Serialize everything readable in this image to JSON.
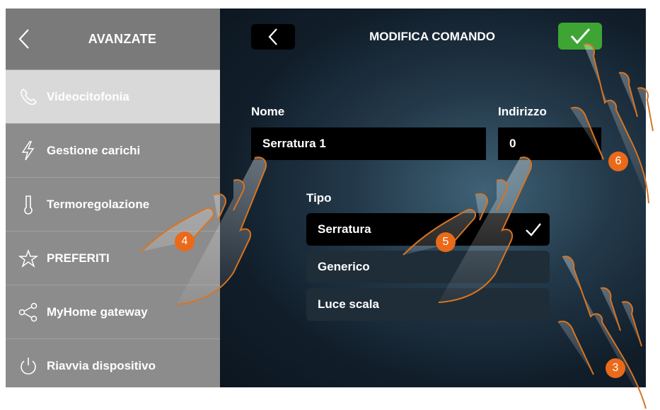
{
  "sidebar": {
    "back_icon": "chevron-left-icon",
    "title": "AVANZATE",
    "items": [
      {
        "label": "Videocitofonia",
        "icon": "phone-icon",
        "active": true
      },
      {
        "label": "Gestione carichi",
        "icon": "lightning-icon",
        "active": false
      },
      {
        "label": "Termoregolazione",
        "icon": "thermometer-icon",
        "active": false
      },
      {
        "label": "PREFERITI",
        "icon": "star-icon",
        "active": false
      },
      {
        "label": "MyHome gateway",
        "icon": "share-icon",
        "active": false
      },
      {
        "label": "Riavvia dispositivo",
        "icon": "power-icon",
        "active": false
      }
    ]
  },
  "header": {
    "title": "MODIFICA COMANDO",
    "back_icon": "chevron-left-icon",
    "confirm_icon": "check-icon",
    "confirm_color": "#3ea535"
  },
  "form": {
    "name_label": "Nome",
    "name_value": "Serratura 1",
    "address_label": "Indirizzo",
    "address_value": "0",
    "type_label": "Tipo",
    "type_options": [
      {
        "label": "Serratura",
        "selected": true
      },
      {
        "label": "Generico",
        "selected": false
      },
      {
        "label": "Luce scala",
        "selected": false
      }
    ]
  },
  "callouts": [
    "3",
    "4",
    "5",
    "6"
  ],
  "callout_color": "#ea6a1a"
}
